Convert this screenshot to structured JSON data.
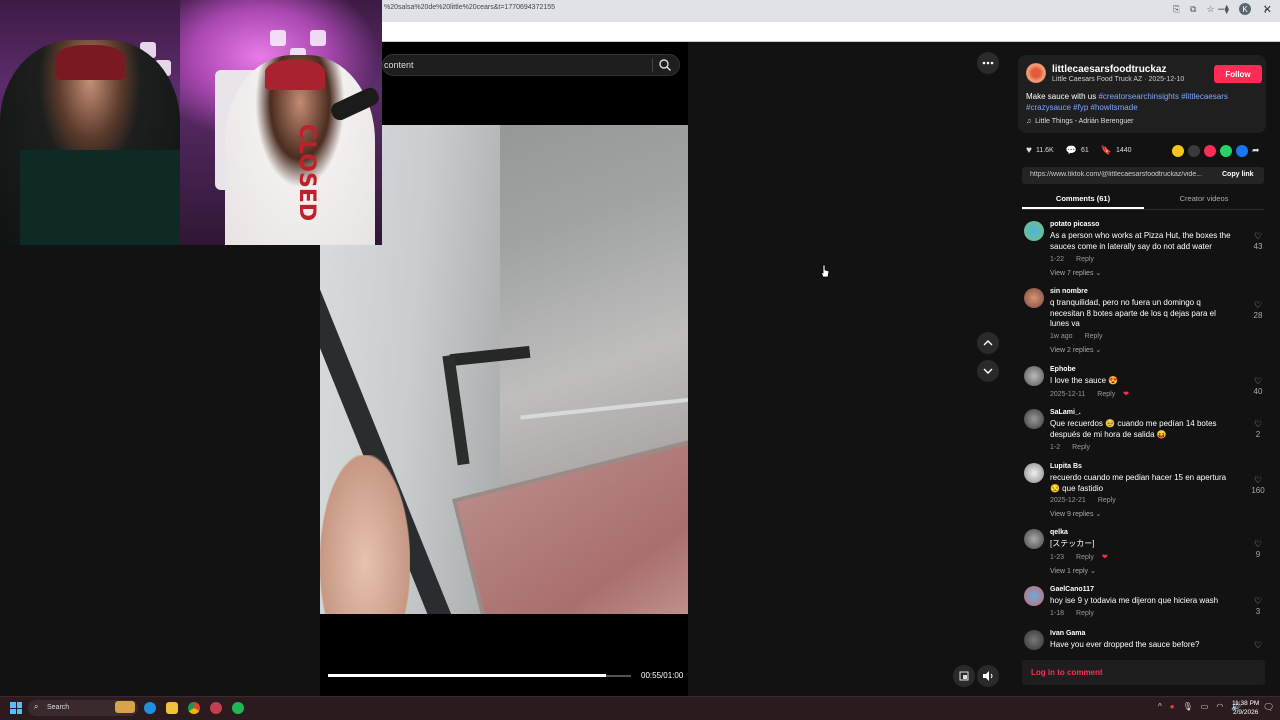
{
  "browser": {
    "url": "%20salsa%20de%20little%20cears&t=1770694372155",
    "window_controls": [
      "–",
      "□",
      "✕"
    ],
    "profile_initial": "K"
  },
  "search": {
    "placeholder": "content"
  },
  "video": {
    "progress": 0.917,
    "time": "00:55/01:00"
  },
  "post": {
    "handle": "littlecaesarsfoodtruckaz",
    "meta": "Little Caesars Food Truck AZ · 2025-12-10",
    "follow_label": "Follow",
    "caption_text": "Make sauce with us ",
    "hashtags": [
      "#creatorsearchinsights",
      "#littlecaesars",
      "#crazysauce",
      "#fyp",
      "#howitsmade"
    ],
    "music": "Little Things - Adrián Berenguer",
    "likes": "11.6K",
    "comments": "61",
    "saves": "1440",
    "link": "https://www.tiktok.com/@littlecaesarsfoodtruckaz/vide...",
    "copy_link_label": "Copy link"
  },
  "tabs": {
    "comments": "Comments (61)",
    "creator": "Creator videos"
  },
  "comments": [
    {
      "user": "potato picasso",
      "text": "As a person who works at Pizza Hut, the boxes the sauces come in laterally say do not add water",
      "date": "1-22",
      "reply": "Reply",
      "replies": "View 7 replies",
      "likes": "43"
    },
    {
      "user": "sin nombre",
      "text": "q tranquilidad, pero no fuera un domingo q necesitan 8 botes aparte de los q dejas para el lunes va",
      "date": "1w ago",
      "reply": "Reply",
      "replies": "View 2 replies",
      "likes": "28"
    },
    {
      "user": "Ephobe",
      "text": "I love the sauce 😍",
      "date": "2025-12-11",
      "reply": "Reply",
      "replies": "",
      "likes": "40"
    },
    {
      "user": "SaLami_.",
      "text": "Que recuerdos 🥹 cuando me pedían 14 botes después de mi hora de salida 😝",
      "date": "1-2",
      "reply": "Reply",
      "replies": "",
      "likes": "2"
    },
    {
      "user": "Lupita Bs",
      "text": "recuerdo cuando me pedian hacer 15 en apertura 😒 que fastidio",
      "date": "2025-12-21",
      "reply": "Reply",
      "replies": "View 9 replies",
      "likes": "160"
    },
    {
      "user": "qelka",
      "text": "[ステッカー]",
      "date": "1-23",
      "reply": "Reply",
      "replies": "View 1 reply",
      "likes": "9"
    },
    {
      "user": "GaelCano117",
      "text": "hoy ise 9 y todavia me dijeron que hiciera wash",
      "date": "1-18",
      "reply": "Reply",
      "replies": "",
      "likes": "3"
    },
    {
      "user": "Ivan Gama",
      "text": "Have you ever dropped the sauce before?",
      "date": "",
      "reply": "",
      "replies": "",
      "likes": ""
    }
  ],
  "login": "Log in to comment",
  "taskbar": {
    "search_label": "Search",
    "time": "11:38 PM",
    "date": "2/9/2026"
  },
  "webcam": {
    "shirt_text": "CLOSED"
  }
}
